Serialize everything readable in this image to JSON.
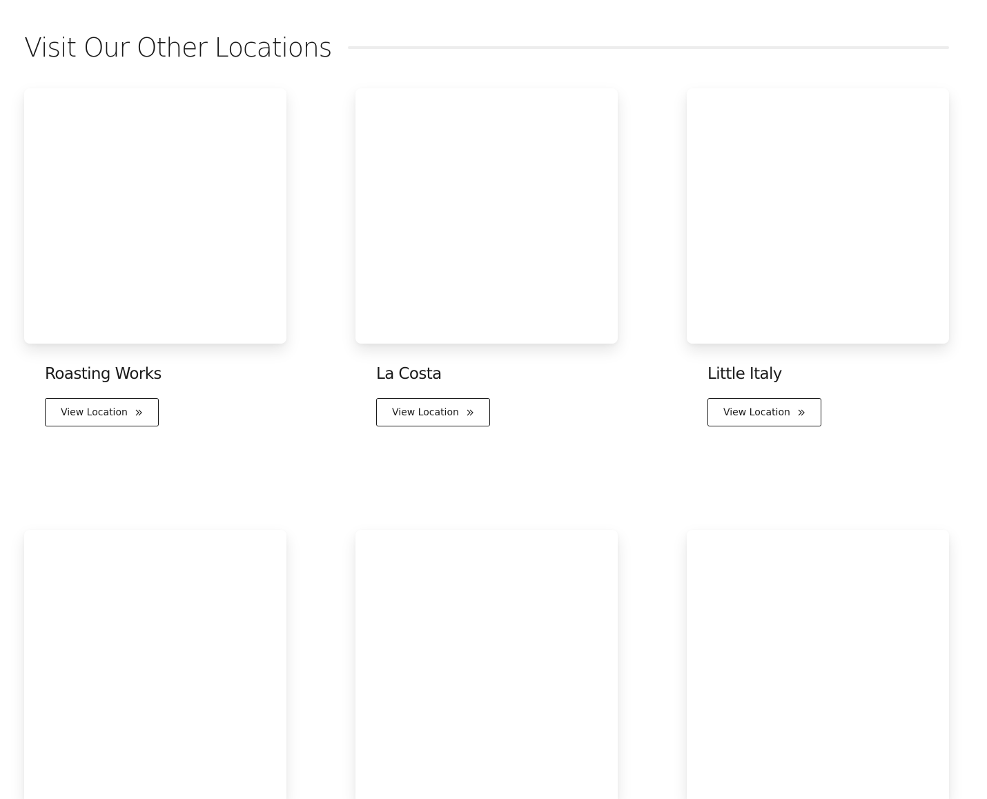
{
  "section": {
    "title": "Visit Our Other Locations"
  },
  "locations": [
    {
      "name": "Roasting Works",
      "button_label": "View Location",
      "button_icon": "double-chevron-right-icon"
    },
    {
      "name": "La Costa",
      "button_label": "View Location",
      "button_icon": "double-chevron-right-icon"
    },
    {
      "name": "Little Italy",
      "button_label": "View Location",
      "button_icon": "double-chevron-right-icon"
    }
  ],
  "colors": {
    "text": "#1a1a1a",
    "rule": "#ededed",
    "background": "#ffffff"
  }
}
